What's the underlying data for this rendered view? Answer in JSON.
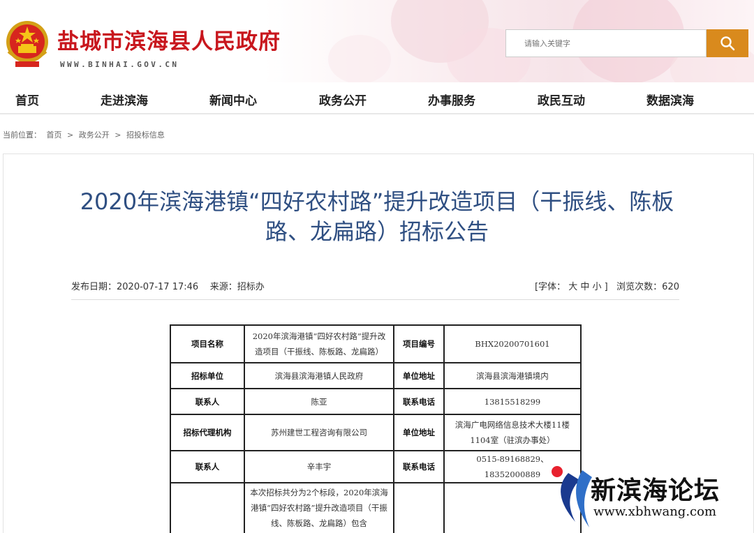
{
  "header": {
    "site_title": "盐城市滨海县人民政府",
    "site_url": "WWW.BINHAI.GOV.CN",
    "search_placeholder": "请输入关键字"
  },
  "nav": {
    "items": [
      "首页",
      "走进滨海",
      "新闻中心",
      "政务公开",
      "办事服务",
      "政民互动",
      "数据滨海"
    ]
  },
  "breadcrumb": {
    "label": "当前位置：",
    "items": [
      "首页",
      "政务公开",
      "招投标信息"
    ],
    "separator": ">"
  },
  "article": {
    "title": "2020年滨海港镇“四好农村路”提升改造项目（干振线、陈板路、龙扁路）招标公告",
    "publish_label": "发布日期：",
    "publish_date": "2020-07-17 17:46",
    "source_label": "来源：",
    "source": "招标办",
    "font_label": "[字体：",
    "font_large": "大",
    "font_medium": "中",
    "font_small": "小",
    "font_close": "]",
    "views_label": "浏览次数：",
    "views": "620"
  },
  "table": {
    "project_name_h": "项目名称",
    "project_name": "2020年滨海港镇“四好农村路”提升改造项目（干振线、陈板路、龙扁路）",
    "project_no_h": "项目编号",
    "project_no": "BHX20200701601",
    "tender_unit_h": "招标单位",
    "tender_unit": "滨海县滨海港镇人民政府",
    "unit_addr_h": "单位地址",
    "unit_addr": "滨海县滨海港镇境内",
    "contact_h": "联系人",
    "contact": "陈亚",
    "phone_h": "联系电话",
    "phone": "13815518299",
    "agency_h": "招标代理机构",
    "agency": "苏州建世工程咨询有限公司",
    "agency_addr_h": "单位地址",
    "agency_addr": "滨海广电网络信息技术大楼11楼1104室（驻滨办事处）",
    "contact2_h": "联系人",
    "contact2": "辛丰宇",
    "phone2_h": "联系电话",
    "phone2": "0515-89168829、18352000889",
    "desc": "本次招标共分为2个标段，2020年滨海港镇“四好农村路”提升改造项目（干振线、陈板路、龙扁路）包含"
  },
  "watermark": {
    "name": "新滨海论坛",
    "url": "www.xbhwang.com"
  },
  "colors": {
    "title_red": "#c8161d",
    "title_blue": "#2f4f82",
    "search_orange": "#d98a1d"
  }
}
